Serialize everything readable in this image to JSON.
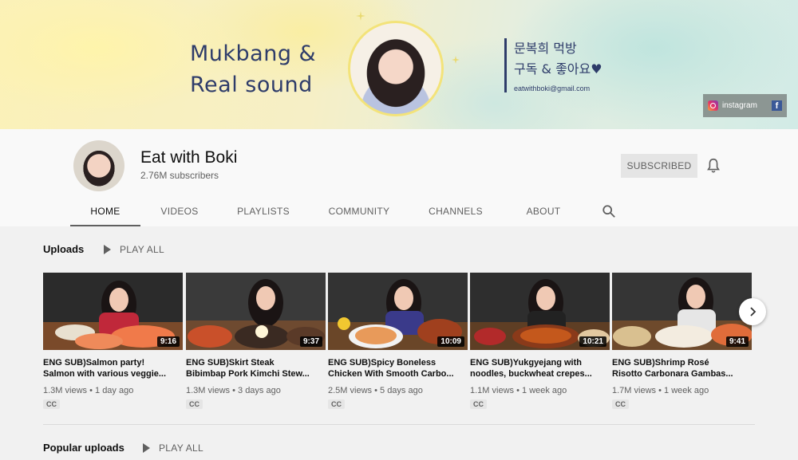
{
  "banner": {
    "title_line1": "Mukbang &",
    "title_line2": "Real sound",
    "korean_line1": "문복희 먹방",
    "korean_line2": "구독 & 좋아요♥",
    "email": "eatwithboki@gmail.com",
    "social": {
      "instagram_label": "instagram",
      "facebook_glyph": "f"
    }
  },
  "channel": {
    "name": "Eat with Boki",
    "subscribers": "2.76M subscribers",
    "subscribe_label": "SUBSCRIBED"
  },
  "tabs": [
    {
      "label": "HOME",
      "active": true
    },
    {
      "label": "VIDEOS",
      "active": false
    },
    {
      "label": "PLAYLISTS",
      "active": false
    },
    {
      "label": "COMMUNITY",
      "active": false
    },
    {
      "label": "CHANNELS",
      "active": false
    },
    {
      "label": "ABOUT",
      "active": false
    }
  ],
  "uploads": {
    "title": "Uploads",
    "play_all": "PLAY ALL",
    "videos": [
      {
        "title1": "ENG SUB)Salmon party!",
        "title2": "Salmon with various veggie...",
        "views": "1.3M views",
        "age": "1 day ago",
        "duration": "9:16",
        "cc": "CC"
      },
      {
        "title1": "ENG SUB)Skirt Steak",
        "title2": "Bibimbap Pork Kimchi Stew...",
        "views": "1.3M views",
        "age": "3 days ago",
        "duration": "9:37",
        "cc": "CC"
      },
      {
        "title1": "ENG SUB)Spicy Boneless",
        "title2": "Chicken With Smooth Carbo...",
        "views": "2.5M views",
        "age": "5 days ago",
        "duration": "10:09",
        "cc": "CC"
      },
      {
        "title1": "ENG SUB)Yukgyejang with",
        "title2": "noodles, buckwheat crepes...",
        "views": "1.1M views",
        "age": "1 week ago",
        "duration": "10:21",
        "cc": "CC"
      },
      {
        "title1": "ENG SUB)Shrimp Rosé",
        "title2": "Risotto Carbonara Gambas...",
        "views": "1.7M views",
        "age": "1 week ago",
        "duration": "9:41",
        "cc": "CC"
      }
    ]
  },
  "popular": {
    "title": "Popular uploads",
    "play_all": "PLAY ALL"
  },
  "meta_separator": "•"
}
